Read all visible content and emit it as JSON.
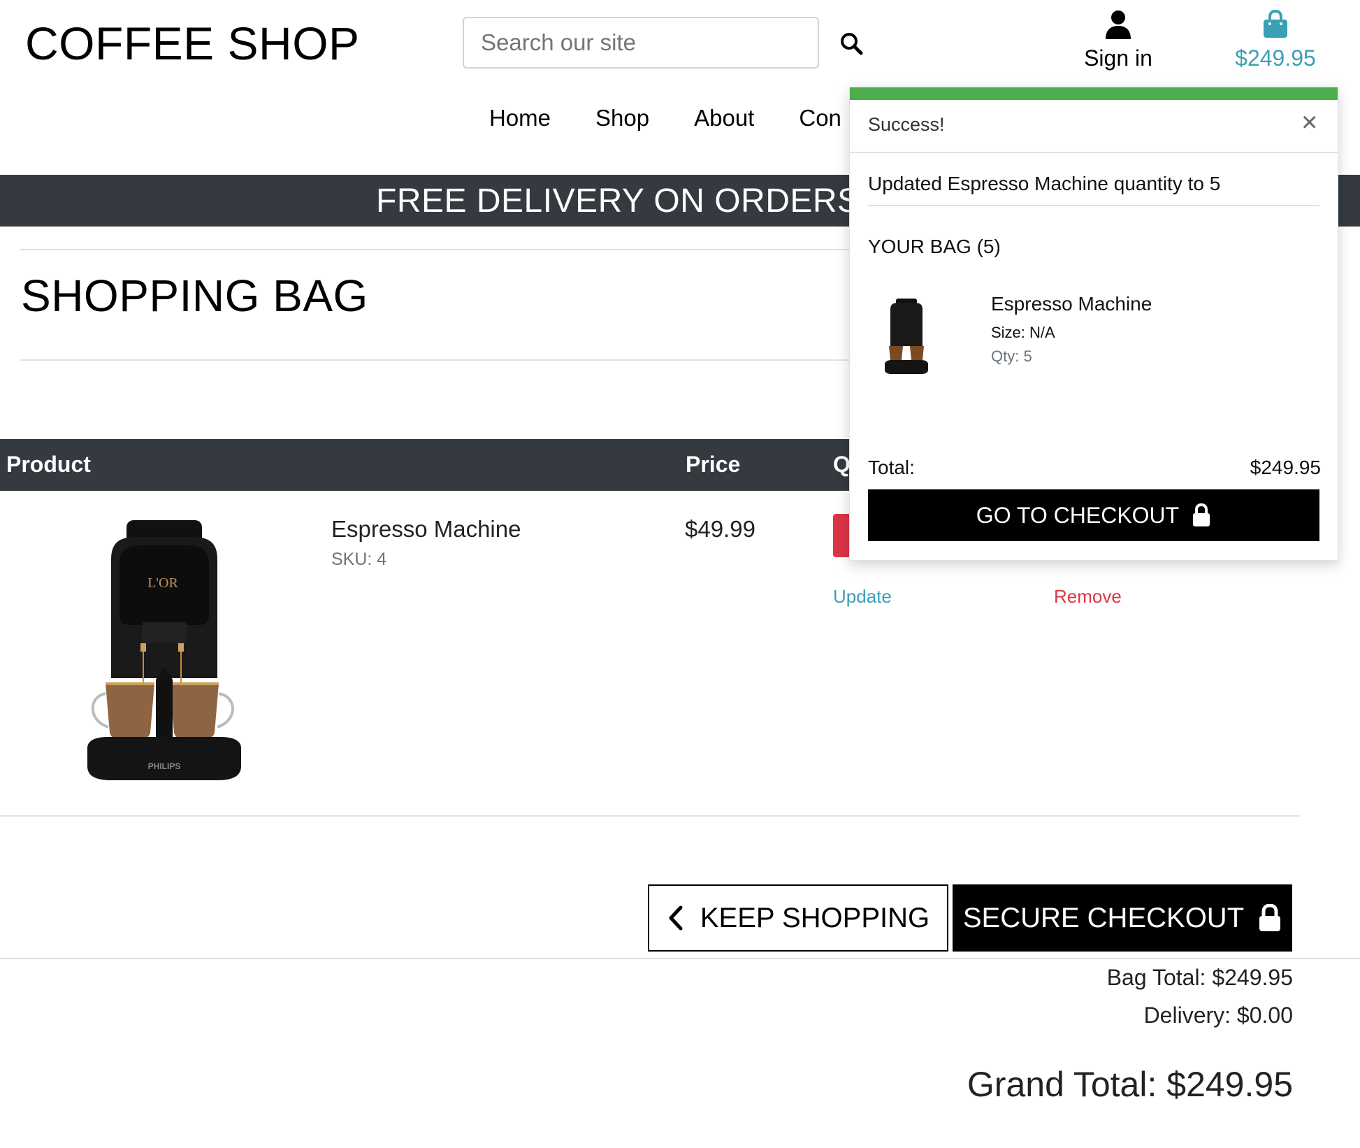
{
  "header": {
    "brand": "COFFEE SHOP",
    "search_placeholder": "Search our site",
    "sign_in_label": "Sign in",
    "bag_total": "$249.95",
    "accent_color": "#3aa0b6"
  },
  "nav": {
    "items": [
      "Home",
      "Shop",
      "About",
      "Con"
    ]
  },
  "banner": {
    "text": "FREE DELIVERY ON ORDERS OV"
  },
  "page": {
    "title": "SHOPPING BAG"
  },
  "table": {
    "headers": [
      "Product",
      "Price",
      "Q"
    ],
    "row": {
      "name": "Espresso Machine",
      "sku": "SKU: 4",
      "price": "$49.99",
      "image_label": "PHILIPS",
      "update_label": "Update",
      "remove_label": "Remove"
    }
  },
  "actions": {
    "keep_shopping": "KEEP SHOPPING",
    "secure_checkout": "SECURE CHECKOUT"
  },
  "summary": {
    "bag_total": "Bag Total: $249.95",
    "delivery": "Delivery: $0.00",
    "grand_total": "Grand Total: $249.95"
  },
  "toast": {
    "title": "Success!",
    "close": "×",
    "message": "Updated Espresso Machine quantity to 5",
    "bag_heading": "YOUR BAG (5)",
    "item_name": "Espresso Machine",
    "item_size": "Size: N/A",
    "item_qty": "Qty: 5",
    "total_label": "Total:",
    "total_value": "$249.95",
    "checkout_label": "GO TO CHECKOUT",
    "bar_color": "#4cae4c"
  },
  "colors": {
    "dark": "#343a40",
    "danger": "#dc3545"
  }
}
